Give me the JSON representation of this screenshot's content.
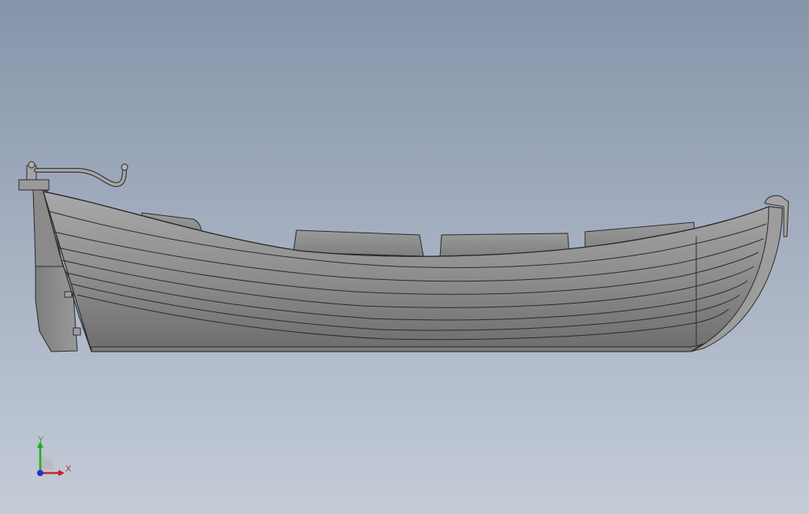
{
  "viewport": {
    "model": "boat-hull-side-view"
  },
  "colors": {
    "background_top": "#8595aa",
    "background_bottom": "#c4ccd8",
    "hull": "#8d8d8d",
    "hull_edge": "#2a2a2a",
    "x_axis": "#cc2222",
    "y_axis": "#22aa22",
    "z_axis": "#2233cc"
  },
  "triad": {
    "x_label": "X",
    "y_label": "Y"
  }
}
